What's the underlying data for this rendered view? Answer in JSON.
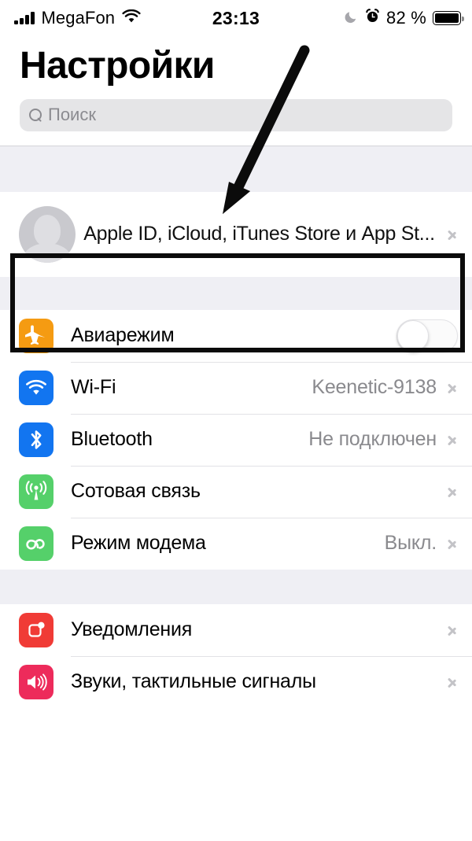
{
  "status_bar": {
    "carrier": "MegaFon",
    "signal_icon": "cellular-bars-icon",
    "wifi_icon": "wifi-icon",
    "time": "23:13",
    "do_not_disturb_icon": "moon-icon",
    "alarm_icon": "alarm-clock-icon",
    "battery_percent": "82 %",
    "battery_icon": "battery-full-icon"
  },
  "header": {
    "title": "Настройки"
  },
  "search": {
    "placeholder": "Поиск",
    "icon": "search-icon"
  },
  "apple_id": {
    "label": "Apple ID, iCloud, iTunes Store и App St...",
    "avatar_icon": "person-placeholder-icon",
    "chevron_icon": "chevron-right-icon",
    "highlighted": true
  },
  "annotation": {
    "box_color": "#0b0b0b",
    "arrow_color": "#0b0b0b",
    "arrow_points_to": "apple-id-row"
  },
  "groups": [
    {
      "rows": [
        {
          "label": "Авиарежим",
          "icon": "airplane-icon",
          "icon_color": "#F59B12",
          "control": "toggle",
          "toggle_on": false,
          "detail": ""
        },
        {
          "label": "Wi-Fi",
          "icon": "wifi-icon",
          "icon_color": "#1275F0",
          "control": "chevron",
          "detail": "Keenetic-9138"
        },
        {
          "label": "Bluetooth",
          "icon": "bluetooth-icon",
          "icon_color": "#1275F0",
          "control": "chevron",
          "detail": "Не подключен"
        },
        {
          "label": "Сотовая связь",
          "icon": "cellular-antenna-icon",
          "icon_color": "#55D06A",
          "control": "chevron",
          "detail": ""
        },
        {
          "label": "Режим модема",
          "icon": "personal-hotspot-icon",
          "icon_color": "#55D06A",
          "control": "chevron",
          "detail": "Выкл."
        }
      ]
    },
    {
      "rows": [
        {
          "label": "Уведомления",
          "icon": "notifications-icon",
          "icon_color": "#F03B36",
          "control": "chevron",
          "detail": ""
        },
        {
          "label": "Звуки, тактильные сигналы",
          "icon": "sounds-haptics-icon",
          "icon_color": "#ED2B5B",
          "control": "chevron",
          "detail": ""
        }
      ]
    }
  ]
}
